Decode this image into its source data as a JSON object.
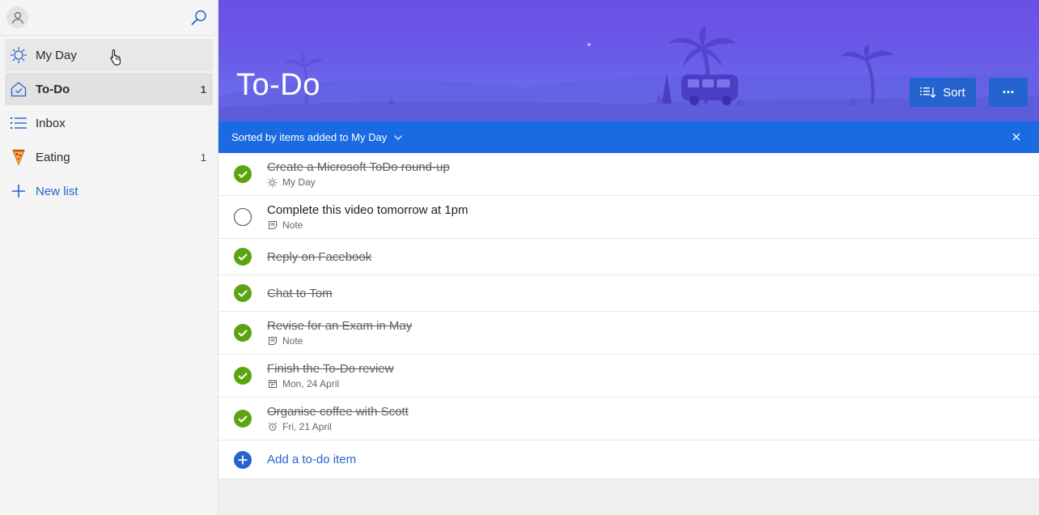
{
  "sidebar": {
    "items": [
      {
        "label": "My Day",
        "count": "",
        "icon": "sun-icon"
      },
      {
        "label": "To-Do",
        "count": "1",
        "icon": "home-icon"
      },
      {
        "label": "Inbox",
        "count": "",
        "icon": "list-icon"
      },
      {
        "label": "Eating",
        "count": "1",
        "icon": "pizza-icon"
      }
    ],
    "new_list_label": "New list"
  },
  "header": {
    "title": "To-Do",
    "sort_label": "Sort",
    "more_glyph": "···"
  },
  "sortbar": {
    "text": "Sorted by items added to My Day"
  },
  "tasks": [
    {
      "title": "Create a Microsoft ToDo round-up",
      "done": true,
      "sub": "My Day",
      "sub_icon": "sun-icon"
    },
    {
      "title": "Complete this video tomorrow at 1pm",
      "done": false,
      "sub": "Note",
      "sub_icon": "note-icon"
    },
    {
      "title": "Reply on Facebook",
      "done": true,
      "sub": "",
      "sub_icon": ""
    },
    {
      "title": "Chat to Tom",
      "done": true,
      "sub": "",
      "sub_icon": ""
    },
    {
      "title": "Revise for an Exam in May",
      "done": true,
      "sub": "Note",
      "sub_icon": "note-icon"
    },
    {
      "title": "Finish the To-Do review",
      "done": true,
      "sub": "Mon, 24 April",
      "sub_icon": "calendar-icon"
    },
    {
      "title": "Organise coffee with Scott",
      "done": true,
      "sub": "Fri, 21 April",
      "sub_icon": "alarm-icon"
    }
  ],
  "add_item_label": "Add a to-do item",
  "colors": {
    "accent": "#2564cf",
    "sortbar": "#1a6ae2",
    "check_done": "#5aa50f",
    "header_top": "#6a4fe4",
    "header_bottom": "#6a76ee"
  }
}
